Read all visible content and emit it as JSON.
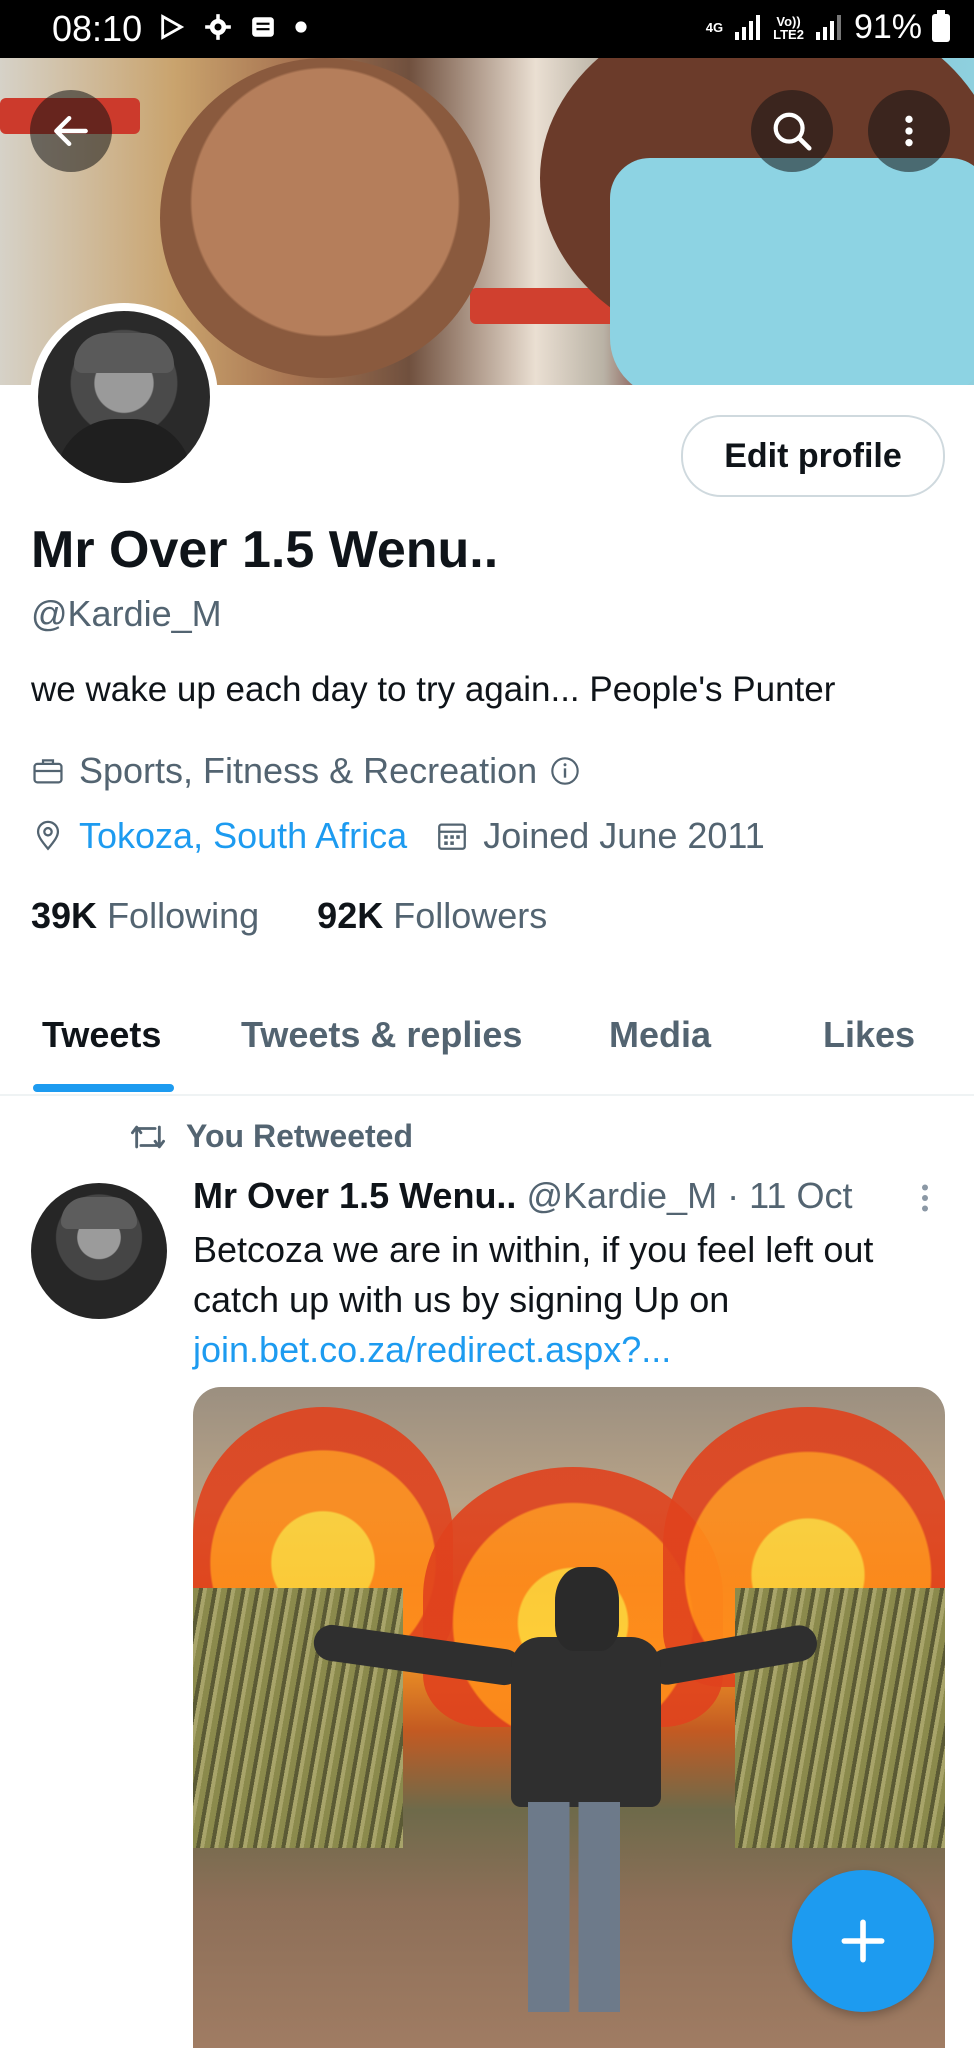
{
  "status_bar": {
    "time": "08:10",
    "network_top": "4G",
    "volte_top": "Vo))",
    "volte_bottom": "LTE2",
    "battery_pct": "91%"
  },
  "profile": {
    "display_name": "Mr Over 1.5 Wenu..",
    "handle": "@Kardie_M",
    "bio": "we wake up each day to try again... People's Punter",
    "category": "Sports, Fitness & Recreation",
    "location": "Tokoza, South Africa",
    "joined": "Joined June 2011",
    "following_count": "39K",
    "following_label": "Following",
    "followers_count": "92K",
    "followers_label": "Followers",
    "edit_button": "Edit profile"
  },
  "tabs": [
    {
      "label": "Tweets",
      "active": true
    },
    {
      "label": "Tweets & replies",
      "active": false
    },
    {
      "label": "Media",
      "active": false
    },
    {
      "label": "Likes",
      "active": false
    }
  ],
  "tweet": {
    "retweet_label": "You Retweeted",
    "author": "Mr Over 1.5 Wenu..",
    "handle": "@Kardie_M",
    "separator": " · ",
    "date": "11 Oct",
    "text": "Betcoza we are in within, if you feel left out catch up with us by signing Up on",
    "link": "join.bet.co.za/redirect.aspx?..."
  },
  "colors": {
    "accent": "#1d9bf0",
    "muted_text": "#536471",
    "primary_text": "#0f1419"
  },
  "icons": [
    "back-arrow-icon",
    "search-icon",
    "more-vertical-icon",
    "briefcase-icon",
    "info-icon",
    "location-pin-icon",
    "calendar-icon",
    "retweet-icon",
    "compose-plus-icon"
  ]
}
